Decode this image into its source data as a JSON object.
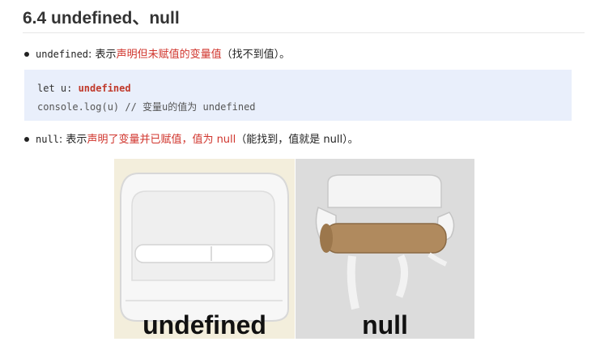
{
  "heading": "6.4 undefined、null",
  "undefined_item": {
    "keyword": "undefined",
    "colon": ":",
    "text_plain_1": " 表示",
    "text_red": "声明但未赋值的变量值",
    "text_plain_2": "（找不到值）。"
  },
  "code": {
    "line1_prefix": "let u: ",
    "line1_type": "undefined",
    "line2": "console.log(u) // 变量u的值为 undefined"
  },
  "null_item": {
    "keyword": "null",
    "colon": ":",
    "text_plain_1": " 表示",
    "text_red": "声明了变量并已赋值，值为 null",
    "text_plain_2": "（能找到，值就是 null）。"
  },
  "image": {
    "left_caption": "undefined",
    "right_caption": "null"
  }
}
